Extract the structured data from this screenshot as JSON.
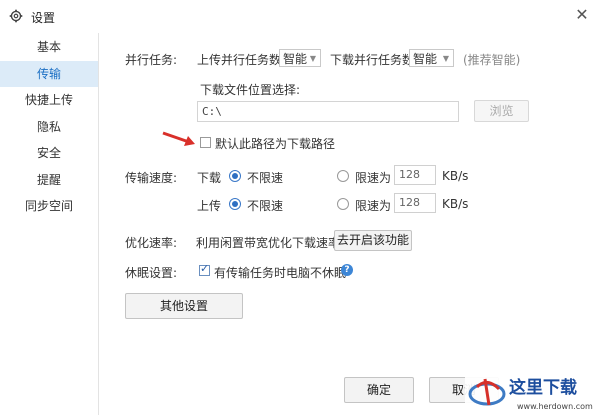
{
  "window": {
    "title": "设置"
  },
  "sidebar": {
    "items": [
      {
        "label": "基本"
      },
      {
        "label": "传输"
      },
      {
        "label": "快捷上传"
      },
      {
        "label": "隐私"
      },
      {
        "label": "安全"
      },
      {
        "label": "提醒"
      },
      {
        "label": "同步空间"
      }
    ]
  },
  "parallel": {
    "label": "并行任务:",
    "upload_label": "上传并行任务数",
    "upload_value": "智能",
    "download_label": "下载并行任务数",
    "download_value": "智能",
    "hint": "(推荐智能)"
  },
  "download_path": {
    "label": "下载文件位置选择:",
    "value": "C:\\",
    "browse_label": "浏览",
    "default_checkbox_label": "默认此路径为下载路径",
    "default_checked": false
  },
  "speed": {
    "label": "传输速度:",
    "download_label": "下载",
    "upload_label": "上传",
    "unlimited_label": "不限速",
    "limit_label": "限速为",
    "download_limit_value": "128",
    "upload_limit_value": "128",
    "unit": "KB/s"
  },
  "optimize": {
    "label": "优化速率:",
    "text": "利用闲置带宽优化下载速率",
    "button_label": "去开启该功能"
  },
  "sleep": {
    "label": "休眠设置:",
    "checkbox_label": "有传输任务时电脑不休眠",
    "checked": true
  },
  "other_settings_label": "其他设置",
  "footer": {
    "ok_label": "确定",
    "cancel_label": "取消"
  },
  "watermark": {
    "text": "这里下载",
    "url": "www.herdown.com"
  },
  "colors": {
    "accent": "#1b6fc4",
    "active_bg": "#dcebf8",
    "arrow": "#d9302a"
  }
}
